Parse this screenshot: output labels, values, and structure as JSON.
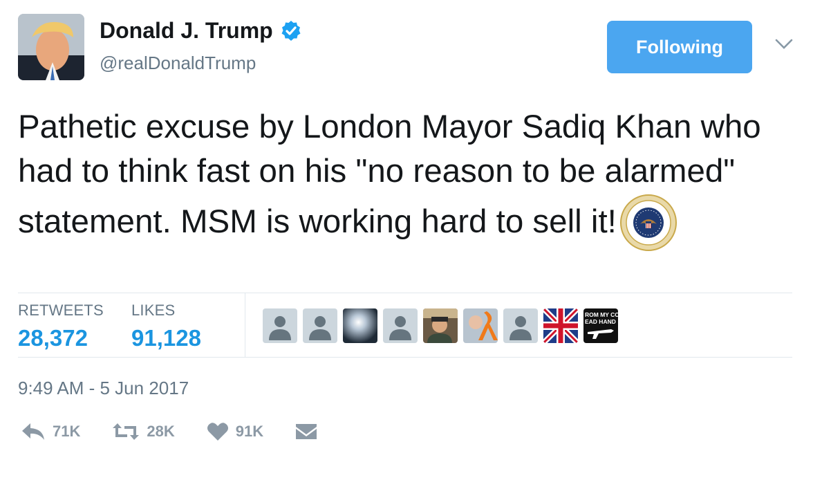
{
  "header": {
    "display_name": "Donald J. Trump",
    "handle": "@realDonaldTrump",
    "follow_label": "Following"
  },
  "tweet": {
    "text": "Pathetic excuse by London Mayor Sadiq Khan who had to think fast on his \"no reason to be alarmed\" statement. MSM is working hard to sell it!",
    "emoji": "presidential-seal-icon"
  },
  "stats": {
    "retweets_label": "RETWEETS",
    "retweets_value": "28,372",
    "likes_label": "LIKES",
    "likes_value": "91,128"
  },
  "likers": [
    {
      "type": "default-avatar"
    },
    {
      "type": "default-avatar"
    },
    {
      "type": "photo-light-burst"
    },
    {
      "type": "default-avatar"
    },
    {
      "type": "photo-person"
    },
    {
      "type": "photo-orange-ribbon"
    },
    {
      "type": "default-avatar"
    },
    {
      "type": "union-jack"
    },
    {
      "type": "text-banner",
      "text_line1": "ROM MY COL",
      "text_line2": "EAD HAND"
    }
  ],
  "timestamp": "9:49 AM - 5 Jun 2017",
  "actions": {
    "reply_count": "71K",
    "retweet_count": "28K",
    "like_count": "91K"
  },
  "colors": {
    "accent": "#1b95e0",
    "follow_button": "#4ba6f0",
    "muted": "#657786",
    "action_gray": "#8c99a5"
  }
}
